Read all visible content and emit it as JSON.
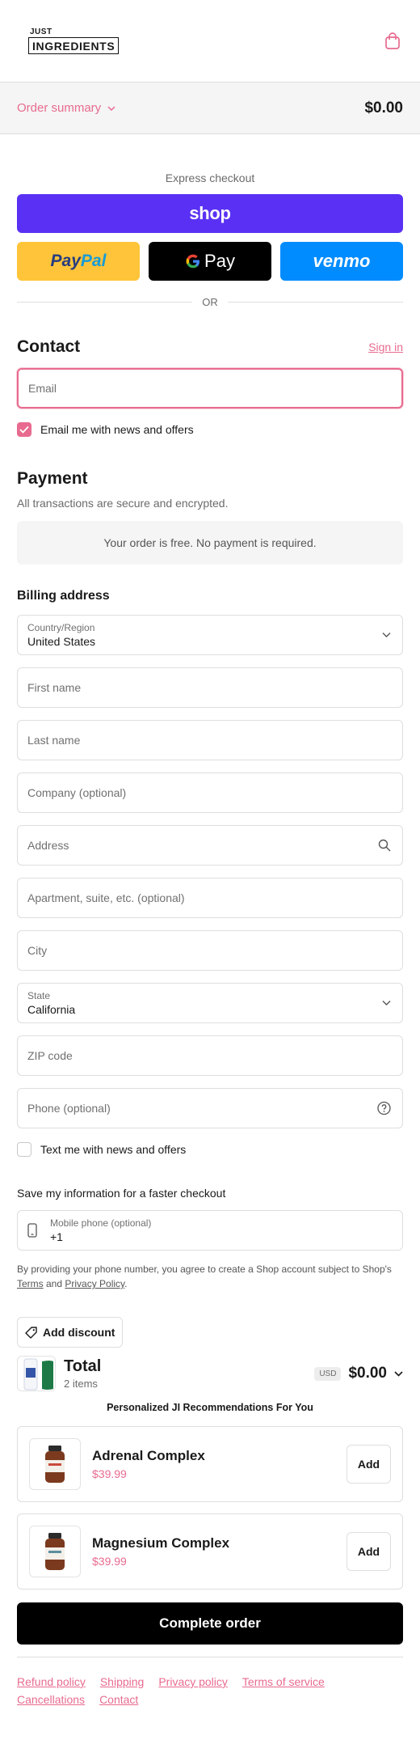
{
  "brand": {
    "logo_line1": "JUST",
    "logo_line2": "INGREDIENTS"
  },
  "summary": {
    "toggle_label": "Order summary",
    "total": "$0.00"
  },
  "express": {
    "title": "Express checkout",
    "shop_label": "shop",
    "paypal_part1": "Pay",
    "paypal_part2": "Pal",
    "gpay_label": "Pay",
    "venmo_label": "venmo",
    "or_label": "OR"
  },
  "contact": {
    "title": "Contact",
    "sign_in": "Sign in",
    "email_placeholder": "Email",
    "news_label": "Email me with news and offers"
  },
  "payment": {
    "title": "Payment",
    "subtitle": "All transactions are secure and encrypted.",
    "free_message": "Your order is free. No payment is required."
  },
  "billing": {
    "title": "Billing address",
    "country_label": "Country/Region",
    "country_value": "United States",
    "first_name": "First name",
    "last_name": "Last name",
    "company": "Company (optional)",
    "address": "Address",
    "apartment": "Apartment, suite, etc. (optional)",
    "city": "City",
    "state_label": "State",
    "state_value": "California",
    "zip": "ZIP code",
    "phone": "Phone (optional)",
    "text_label": "Text me with news and offers"
  },
  "save_info": {
    "title": "Save my information for a faster checkout",
    "mobile_label": "Mobile phone (optional)",
    "mobile_value": "+1",
    "terms_part1": "By providing your phone number, you agree to create a Shop account subject to Shop's ",
    "terms_link": "Terms",
    "terms_and": " and ",
    "privacy_link": "Privacy Policy",
    "terms_end": "."
  },
  "discount": {
    "label": "Add discount"
  },
  "total": {
    "label": "Total",
    "items": "2 items",
    "currency": "USD",
    "amount": "$0.00"
  },
  "recommendations": {
    "title": "Personalized JI Recommendations For You",
    "products": [
      {
        "name": "Adrenal Complex",
        "price": "$39.99",
        "add": "Add"
      },
      {
        "name": "Magnesium Complex",
        "price": "$39.99",
        "add": "Add"
      }
    ]
  },
  "complete": {
    "label": "Complete order"
  },
  "footer": {
    "links": [
      "Refund policy",
      "Shipping",
      "Privacy policy",
      "Terms of service",
      "Cancellations",
      "Contact"
    ]
  },
  "colors": {
    "accent": "#e86b8f",
    "shop": "#5a31f4",
    "paypal": "#ffc439",
    "venmo": "#008cff"
  }
}
